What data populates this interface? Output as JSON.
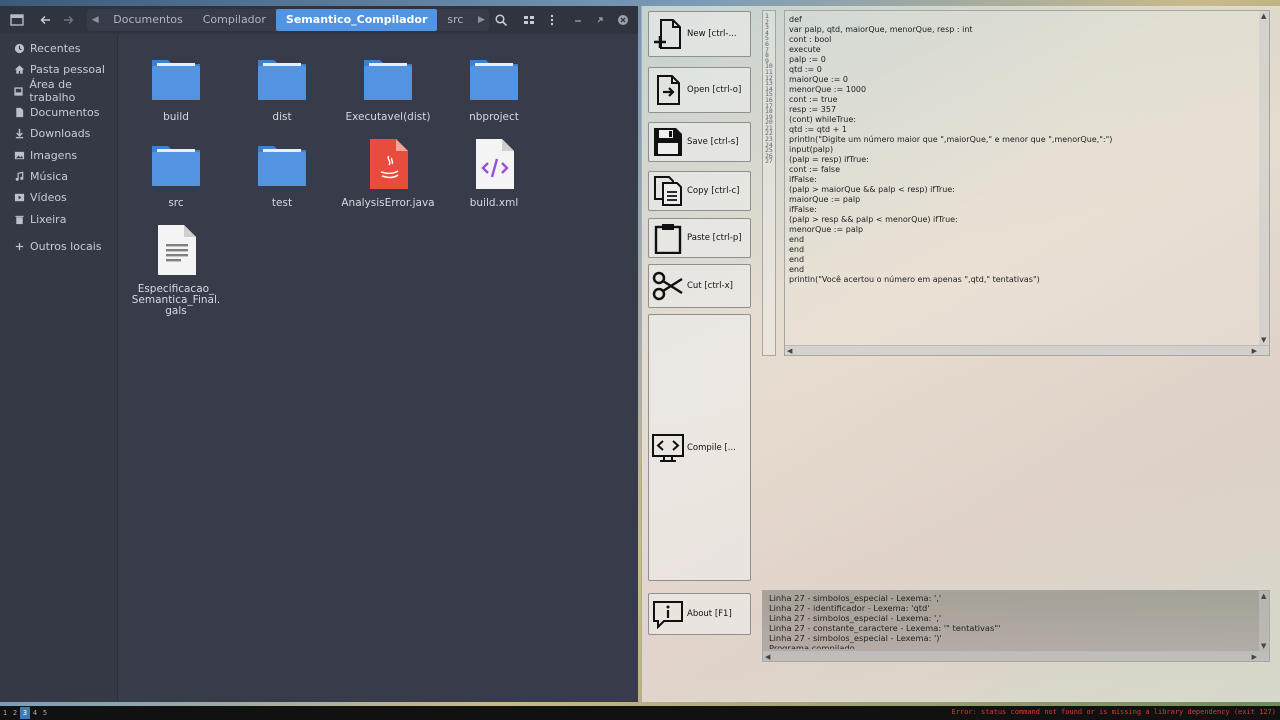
{
  "file_manager": {
    "breadcrumbs": [
      "Documentos",
      "Compilador",
      "Semantico_Compilador",
      "src"
    ],
    "active_crumb": "Semantico_Compilador",
    "sidebar": [
      {
        "label": "Recentes",
        "icon": "clock-icon"
      },
      {
        "label": "Pasta pessoal",
        "icon": "home-icon"
      },
      {
        "label": "Área de trabalho",
        "icon": "desktop-icon"
      },
      {
        "label": "Documentos",
        "icon": "document-icon"
      },
      {
        "label": "Downloads",
        "icon": "download-icon"
      },
      {
        "label": "Imagens",
        "icon": "image-icon"
      },
      {
        "label": "Música",
        "icon": "music-icon"
      },
      {
        "label": "Vídeos",
        "icon": "video-icon"
      },
      {
        "label": "Lixeira",
        "icon": "trash-icon"
      },
      {
        "label": "Outros locais",
        "icon": "plus-icon"
      }
    ],
    "files": [
      {
        "label": "build",
        "type": "folder"
      },
      {
        "label": "dist",
        "type": "folder"
      },
      {
        "label": "Executavel(dist)",
        "type": "folder"
      },
      {
        "label": "nbproject",
        "type": "folder"
      },
      {
        "label": "src",
        "type": "folder"
      },
      {
        "label": "test",
        "type": "folder"
      },
      {
        "label": "AnalysisError.java",
        "type": "java"
      },
      {
        "label": "build.xml",
        "type": "xml"
      },
      {
        "label": "Especificacao_\nSemantica_Final.\ngals",
        "type": "text"
      }
    ]
  },
  "app": {
    "buttons": {
      "new": "New [ctrl-...",
      "open": "Open [ctrl-o]",
      "save": "Save [ctrl-s]",
      "copy": "Copy [ctrl-c]",
      "paste": "Paste [ctrl-p]",
      "cut": "Cut [ctrl-x]",
      "compile": "Compile [...",
      "about": "About [F1]"
    },
    "line_numbers": "1\n2\n3\n4\n5\n6\n7\n8\n9\n10\n11\n12\n13\n14\n15\n16\n17\n18\n19\n20\n21\n22\n23\n24\n25\n26\n27",
    "code": "def\nvar palp, qtd, maiorQue, menorQue, resp : int\ncont : bool\nexecute\npalp := 0\nqtd := 0\nmaiorQue := 0\nmenorQue := 1000\ncont := true\nresp := 357\n(cont) whileTrue:\nqtd := qtd + 1\nprintln(\"Digite um número maior que \",maiorQue,\" e menor que \",menorQue,\":\")\ninput(palp)\n(palp = resp) ifTrue:\ncont := false\nifFalse:\n(palp > maiorQue && palp < resp) ifTrue:\nmaiorQue := palp\nifFalse:\n(palp > resp && palp < menorQue) ifTrue:\nmenorQue := palp\nend\nend\nend\nend\nprintln(\"Você acertou o número em apenas \",qtd,\" tentativas\")",
    "console": "Linha 27 - simbolos_especial - Lexema: ','\nLinha 27 - identificador - Lexema: 'qtd'\nLinha 27 - simbolos_especial - Lexema: ','\nLinha 27 - constante_caractere - Lexema: '\" tentativas\"'\nLinha 27 - simbolos_especial - Lexema: ')'\nPrograma compilado."
  },
  "taskbar": {
    "workspaces": [
      "1",
      "2",
      "3",
      "4",
      "5"
    ],
    "active_workspace": "3",
    "error": "Error: status command not found or is missing a library dependency (exit 127)"
  },
  "colors": {
    "accent": "#5294e2",
    "folder": "#5294e2",
    "java": "#e74c3c",
    "error": "#d23b3b"
  }
}
